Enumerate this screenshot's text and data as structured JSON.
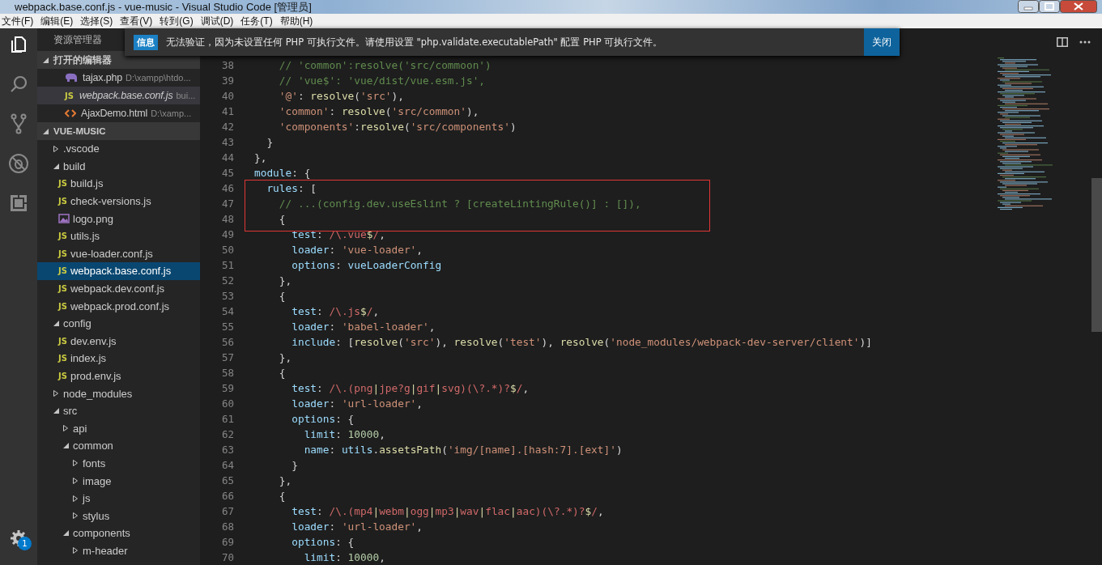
{
  "window": {
    "title": "webpack.base.conf.js - vue-music - Visual Studio Code [管理员]"
  },
  "menu": [
    "文件(F)",
    "编辑(E)",
    "选择(S)",
    "查看(V)",
    "转到(G)",
    "调试(D)",
    "任务(T)",
    "帮助(H)"
  ],
  "activity_bar": [
    {
      "kind": "files",
      "selected": true
    },
    {
      "kind": "search",
      "selected": false
    },
    {
      "kind": "source-control",
      "selected": false
    },
    {
      "kind": "debug",
      "selected": false
    },
    {
      "kind": "extensions",
      "selected": false
    }
  ],
  "settings_badge": "1",
  "sidebar": {
    "title": "资源管理器",
    "open_editors": {
      "title": "打开的编辑器",
      "expanded": true,
      "items": [
        {
          "name": "tajax.php",
          "path": "D:\\xampp\\htdo...",
          "kind": "php",
          "selected": false,
          "preview": false
        },
        {
          "name": "webpack.base.conf.js",
          "path": "bui...",
          "kind": "js",
          "icon_text": "JS",
          "selected": true,
          "preview": true
        },
        {
          "name": "AjaxDemo.html",
          "path": "D:\\xamp...",
          "kind": "html",
          "selected": false,
          "preview": false
        }
      ]
    },
    "project": {
      "title": "VUE-MUSIC",
      "expanded": true,
      "tree": [
        {
          "name": ".vscode",
          "kind": "folder",
          "expanded": false,
          "selected": false
        },
        {
          "name": "build",
          "kind": "folder",
          "expanded": true,
          "selected": false,
          "children": [
            {
              "name": "build.js",
              "kind": "js",
              "icon_text": "JS",
              "selected": false
            },
            {
              "name": "check-versions.js",
              "kind": "js",
              "icon_text": "JS",
              "selected": false
            },
            {
              "name": "logo.png",
              "kind": "image",
              "selected": false
            },
            {
              "name": "utils.js",
              "kind": "js",
              "icon_text": "JS",
              "selected": false
            },
            {
              "name": "vue-loader.conf.js",
              "kind": "js",
              "icon_text": "JS",
              "selected": false
            },
            {
              "name": "webpack.base.conf.js",
              "kind": "js",
              "icon_text": "JS",
              "selected": true
            },
            {
              "name": "webpack.dev.conf.js",
              "kind": "js",
              "icon_text": "JS",
              "selected": false
            },
            {
              "name": "webpack.prod.conf.js",
              "kind": "js",
              "icon_text": "JS",
              "selected": false
            }
          ]
        },
        {
          "name": "config",
          "kind": "folder",
          "expanded": true,
          "selected": false,
          "children": [
            {
              "name": "dev.env.js",
              "kind": "js",
              "icon_text": "JS",
              "selected": false
            },
            {
              "name": "index.js",
              "kind": "js",
              "icon_text": "JS",
              "selected": false
            },
            {
              "name": "prod.env.js",
              "kind": "js",
              "icon_text": "JS",
              "selected": false
            }
          ]
        },
        {
          "name": "node_modules",
          "kind": "folder",
          "expanded": false,
          "selected": false
        },
        {
          "name": "src",
          "kind": "folder",
          "expanded": true,
          "selected": false,
          "children": [
            {
              "name": "api",
              "kind": "folder",
              "expanded": false,
              "selected": false
            },
            {
              "name": "common",
              "kind": "folder",
              "expanded": true,
              "selected": false,
              "children": [
                {
                  "name": "fonts",
                  "kind": "folder",
                  "expanded": false,
                  "selected": false
                },
                {
                  "name": "image",
                  "kind": "folder",
                  "expanded": false,
                  "selected": false
                },
                {
                  "name": "js",
                  "kind": "folder",
                  "expanded": false,
                  "selected": false
                },
                {
                  "name": "stylus",
                  "kind": "folder",
                  "expanded": false,
                  "selected": false
                }
              ]
            },
            {
              "name": "components",
              "kind": "folder",
              "expanded": true,
              "selected": false,
              "children": [
                {
                  "name": "m-header",
                  "kind": "folder",
                  "expanded": false,
                  "selected": false
                }
              ]
            }
          ]
        }
      ]
    }
  },
  "notification": {
    "badge": "信息",
    "message": "无法验证，因为未设置任何 PHP 可执行文件。请使用设置 \"php.validate.executablePath\" 配置 PHP 可执行文件。",
    "button": "关闭"
  },
  "editor": {
    "lines": [
      {
        "number": "38",
        "tokens": [
          {
            "t": "    // 'common':resolve('src/commoon')",
            "kind": "comment"
          }
        ]
      },
      {
        "number": "39",
        "tokens": [
          {
            "t": "    // 'vue$': 'vue/dist/vue.esm.js',",
            "kind": "comment"
          }
        ]
      },
      {
        "number": "40",
        "tokens": [
          {
            "t": "    '@'",
            "kind": "string"
          },
          {
            "t": ": ",
            "kind": "plain"
          },
          {
            "t": "resolve",
            "kind": "func"
          },
          {
            "t": "(",
            "kind": "plain"
          },
          {
            "t": "'src'",
            "kind": "string"
          },
          {
            "t": "),",
            "kind": "plain"
          }
        ]
      },
      {
        "number": "41",
        "tokens": [
          {
            "t": "    'common'",
            "kind": "string"
          },
          {
            "t": ": ",
            "kind": "plain"
          },
          {
            "t": "resolve",
            "kind": "func"
          },
          {
            "t": "(",
            "kind": "plain"
          },
          {
            "t": "'src/common'",
            "kind": "string"
          },
          {
            "t": "),",
            "kind": "plain"
          }
        ]
      },
      {
        "number": "42",
        "tokens": [
          {
            "t": "    'components'",
            "kind": "string"
          },
          {
            "t": ":",
            "kind": "plain"
          },
          {
            "t": "resolve",
            "kind": "func"
          },
          {
            "t": "(",
            "kind": "plain"
          },
          {
            "t": "'src/components'",
            "kind": "string"
          },
          {
            "t": ")",
            "kind": "plain"
          }
        ]
      },
      {
        "number": "43",
        "tokens": [
          {
            "t": "  }",
            "kind": "plain"
          }
        ]
      },
      {
        "number": "44",
        "tokens": [
          {
            "t": "},",
            "kind": "plain"
          }
        ]
      },
      {
        "number": "45",
        "tokens": [
          {
            "t": "module",
            "kind": "prop"
          },
          {
            "t": ": {",
            "kind": "plain"
          }
        ]
      },
      {
        "number": "46",
        "tokens": [
          {
            "t": "  rules",
            "kind": "prop"
          },
          {
            "t": ": [",
            "kind": "plain"
          }
        ]
      },
      {
        "number": "47",
        "tokens": [
          {
            "t": "    // ...(config.dev.useEslint ? [createLintingRule()] : []),",
            "kind": "comment"
          }
        ]
      },
      {
        "number": "48",
        "tokens": [
          {
            "t": "    {",
            "kind": "plain"
          }
        ]
      },
      {
        "number": "49",
        "tokens": [
          {
            "t": "      test",
            "kind": "prop"
          },
          {
            "t": ": ",
            "kind": "plain"
          },
          {
            "t": "/\\.vue",
            "kind": "regex"
          },
          {
            "t": "$",
            "kind": "func"
          },
          {
            "t": "/",
            "kind": "regex"
          },
          {
            "t": ",",
            "kind": "plain"
          }
        ]
      },
      {
        "number": "50",
        "tokens": [
          {
            "t": "      loader",
            "kind": "prop"
          },
          {
            "t": ": ",
            "kind": "plain"
          },
          {
            "t": "'vue-loader'",
            "kind": "string"
          },
          {
            "t": ",",
            "kind": "plain"
          }
        ]
      },
      {
        "number": "51",
        "tokens": [
          {
            "t": "      options",
            "kind": "prop"
          },
          {
            "t": ": ",
            "kind": "plain"
          },
          {
            "t": "vueLoaderConfig",
            "kind": "prop"
          }
        ]
      },
      {
        "number": "52",
        "tokens": [
          {
            "t": "    },",
            "kind": "plain"
          }
        ]
      },
      {
        "number": "53",
        "tokens": [
          {
            "t": "    {",
            "kind": "plain"
          }
        ]
      },
      {
        "number": "54",
        "tokens": [
          {
            "t": "      test",
            "kind": "prop"
          },
          {
            "t": ": ",
            "kind": "plain"
          },
          {
            "t": "/\\.js",
            "kind": "regex"
          },
          {
            "t": "$",
            "kind": "func"
          },
          {
            "t": "/",
            "kind": "regex"
          },
          {
            "t": ",",
            "kind": "plain"
          }
        ]
      },
      {
        "number": "55",
        "tokens": [
          {
            "t": "      loader",
            "kind": "prop"
          },
          {
            "t": ": ",
            "kind": "plain"
          },
          {
            "t": "'babel-loader'",
            "kind": "string"
          },
          {
            "t": ",",
            "kind": "plain"
          }
        ]
      },
      {
        "number": "56",
        "tokens": [
          {
            "t": "      include",
            "kind": "prop"
          },
          {
            "t": ": [",
            "kind": "plain"
          },
          {
            "t": "resolve",
            "kind": "func"
          },
          {
            "t": "(",
            "kind": "plain"
          },
          {
            "t": "'src'",
            "kind": "string"
          },
          {
            "t": "), ",
            "kind": "plain"
          },
          {
            "t": "resolve",
            "kind": "func"
          },
          {
            "t": "(",
            "kind": "plain"
          },
          {
            "t": "'test'",
            "kind": "string"
          },
          {
            "t": "), ",
            "kind": "plain"
          },
          {
            "t": "resolve",
            "kind": "func"
          },
          {
            "t": "(",
            "kind": "plain"
          },
          {
            "t": "'node_modules/webpack-dev-server/client'",
            "kind": "string"
          },
          {
            "t": ")]",
            "kind": "plain"
          }
        ]
      },
      {
        "number": "57",
        "tokens": [
          {
            "t": "    },",
            "kind": "plain"
          }
        ]
      },
      {
        "number": "58",
        "tokens": [
          {
            "t": "    {",
            "kind": "plain"
          }
        ]
      },
      {
        "number": "59",
        "tokens": [
          {
            "t": "      test",
            "kind": "prop"
          },
          {
            "t": ": ",
            "kind": "plain"
          },
          {
            "t": "/\\.(png",
            "kind": "regex"
          },
          {
            "t": "|",
            "kind": "func"
          },
          {
            "t": "jpe?g",
            "kind": "regex"
          },
          {
            "t": "|",
            "kind": "func"
          },
          {
            "t": "gif",
            "kind": "regex"
          },
          {
            "t": "|",
            "kind": "func"
          },
          {
            "t": "svg)(\\?.*)?",
            "kind": "regex"
          },
          {
            "t": "$",
            "kind": "func"
          },
          {
            "t": "/",
            "kind": "regex"
          },
          {
            "t": ",",
            "kind": "plain"
          }
        ]
      },
      {
        "number": "60",
        "tokens": [
          {
            "t": "      loader",
            "kind": "prop"
          },
          {
            "t": ": ",
            "kind": "plain"
          },
          {
            "t": "'url-loader'",
            "kind": "string"
          },
          {
            "t": ",",
            "kind": "plain"
          }
        ]
      },
      {
        "number": "61",
        "tokens": [
          {
            "t": "      options",
            "kind": "prop"
          },
          {
            "t": ": {",
            "kind": "plain"
          }
        ]
      },
      {
        "number": "62",
        "tokens": [
          {
            "t": "        limit",
            "kind": "prop"
          },
          {
            "t": ": ",
            "kind": "plain"
          },
          {
            "t": "10000",
            "kind": "number"
          },
          {
            "t": ",",
            "kind": "plain"
          }
        ]
      },
      {
        "number": "63",
        "tokens": [
          {
            "t": "        name",
            "kind": "prop"
          },
          {
            "t": ": ",
            "kind": "plain"
          },
          {
            "t": "utils",
            "kind": "prop"
          },
          {
            "t": ".",
            "kind": "plain"
          },
          {
            "t": "assetsPath",
            "kind": "func"
          },
          {
            "t": "(",
            "kind": "plain"
          },
          {
            "t": "'img/[name].[hash:7].[ext]'",
            "kind": "string"
          },
          {
            "t": ")",
            "kind": "plain"
          }
        ]
      },
      {
        "number": "64",
        "tokens": [
          {
            "t": "      }",
            "kind": "plain"
          }
        ]
      },
      {
        "number": "65",
        "tokens": [
          {
            "t": "    },",
            "kind": "plain"
          }
        ]
      },
      {
        "number": "66",
        "tokens": [
          {
            "t": "    {",
            "kind": "plain"
          }
        ]
      },
      {
        "number": "67",
        "tokens": [
          {
            "t": "      test",
            "kind": "prop"
          },
          {
            "t": ": ",
            "kind": "plain"
          },
          {
            "t": "/\\.(mp4",
            "kind": "regex"
          },
          {
            "t": "|",
            "kind": "func"
          },
          {
            "t": "webm",
            "kind": "regex"
          },
          {
            "t": "|",
            "kind": "func"
          },
          {
            "t": "ogg",
            "kind": "regex"
          },
          {
            "t": "|",
            "kind": "func"
          },
          {
            "t": "mp3",
            "kind": "regex"
          },
          {
            "t": "|",
            "kind": "func"
          },
          {
            "t": "wav",
            "kind": "regex"
          },
          {
            "t": "|",
            "kind": "func"
          },
          {
            "t": "flac",
            "kind": "regex"
          },
          {
            "t": "|",
            "kind": "func"
          },
          {
            "t": "aac)(\\?.*)?",
            "kind": "regex"
          },
          {
            "t": "$",
            "kind": "func"
          },
          {
            "t": "/",
            "kind": "regex"
          },
          {
            "t": ",",
            "kind": "plain"
          }
        ]
      },
      {
        "number": "68",
        "tokens": [
          {
            "t": "      loader",
            "kind": "prop"
          },
          {
            "t": ": ",
            "kind": "plain"
          },
          {
            "t": "'url-loader'",
            "kind": "string"
          },
          {
            "t": ",",
            "kind": "plain"
          }
        ]
      },
      {
        "number": "69",
        "tokens": [
          {
            "t": "      options",
            "kind": "prop"
          },
          {
            "t": ": {",
            "kind": "plain"
          }
        ]
      },
      {
        "number": "70",
        "tokens": [
          {
            "t": "        limit",
            "kind": "prop"
          },
          {
            "t": ": ",
            "kind": "plain"
          },
          {
            "t": "10000",
            "kind": "number"
          },
          {
            "t": ",",
            "kind": "plain"
          }
        ]
      }
    ]
  }
}
